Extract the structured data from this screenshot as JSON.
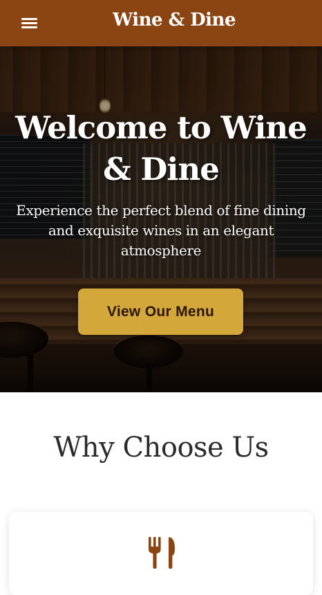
{
  "header": {
    "brand": "Wine & Dine",
    "menu_icon": "hamburger-menu-icon",
    "background": "#8b4513"
  },
  "hero": {
    "title": "Welcome to Wine & Dine",
    "subtitle": "Experience the perfect blend of fine dining and exquisite wines in an elegant atmosphere",
    "cta_label": "View Our Menu",
    "cta_color": "#d4a73a"
  },
  "features": {
    "section_title": "Why Choose Us",
    "cards": [
      {
        "icon": "utensils-icon",
        "icon_color": "#8b4513"
      }
    ]
  }
}
